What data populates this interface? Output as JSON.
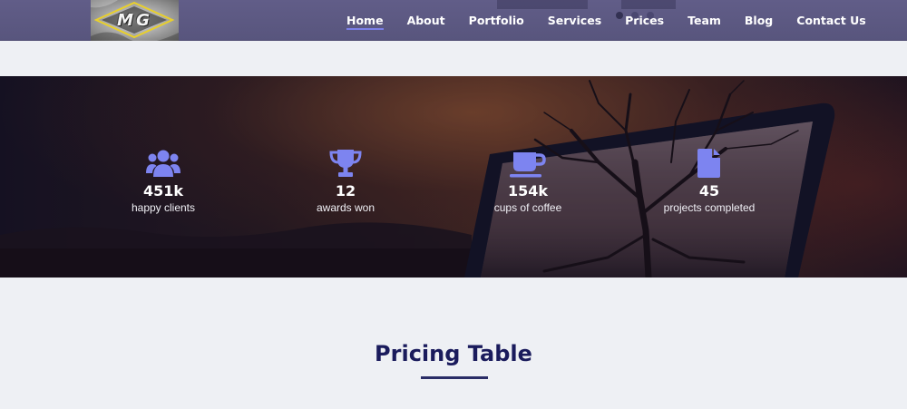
{
  "header": {
    "logo_text": "MG",
    "nav": [
      {
        "label": "Home",
        "active": true
      },
      {
        "label": "About"
      },
      {
        "label": "Portfolio"
      },
      {
        "label": "Services"
      },
      {
        "label": "Prices"
      },
      {
        "label": "Team"
      },
      {
        "label": "Blog"
      },
      {
        "label": "Contact Us"
      }
    ]
  },
  "stats": [
    {
      "icon": "users-icon",
      "number": "451k",
      "label": "happy clients"
    },
    {
      "icon": "trophy-icon",
      "number": "12",
      "label": "awards won"
    },
    {
      "icon": "coffee-cup-icon",
      "number": "154k",
      "label": "cups of coffee"
    },
    {
      "icon": "document-icon",
      "number": "45",
      "label": "projects completed"
    }
  ],
  "pricing": {
    "title": "Pricing Table"
  },
  "colors": {
    "nav_bg": "#5d5a85",
    "accent": "#7b7fe8",
    "icon": "#7d84f0",
    "heading": "#1a1b5c",
    "page_bg": "#eef0f4"
  }
}
